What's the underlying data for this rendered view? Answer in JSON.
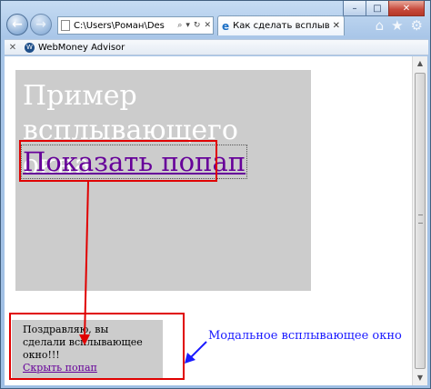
{
  "browser": {
    "address_text": "C:\\Users\\Роман\\Des",
    "tab_title": "Как сделать всплыва...",
    "favorites": {
      "item_label": "WebMoney Advisor"
    }
  },
  "page": {
    "heading": "Пример всплывающего окна",
    "show_link": "Показать попап",
    "popup": {
      "text": "Поздравляю, вы сделали всплывающее окно!!!",
      "hide_link": "Скрыть попап"
    }
  },
  "annotation": {
    "label": "Модальное всплывающее окно",
    "box_color": "#e00000",
    "arrow_color": "#1a1aff"
  },
  "icons": {
    "back": "back-arrow-icon",
    "forward": "forward-arrow-icon",
    "home": "home-icon",
    "favorites": "star-icon",
    "settings": "gear-icon"
  }
}
